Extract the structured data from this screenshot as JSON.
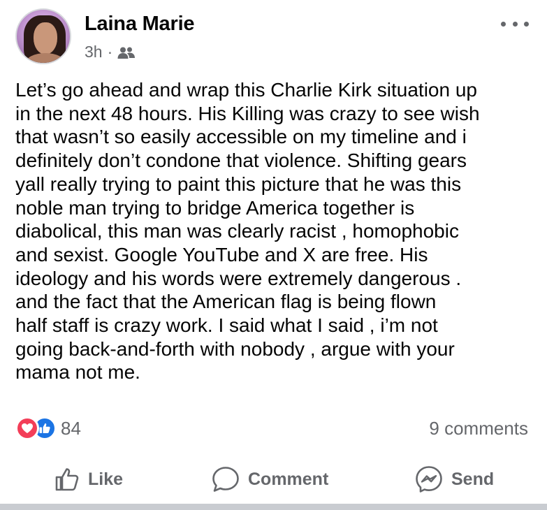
{
  "author": {
    "name": "Laina Marie",
    "time": "3h",
    "separator": "·",
    "audience_icon": "friends-icon"
  },
  "post": {
    "text": "Let’s go ahead and wrap this Charlie Kirk situation up\nin the next 48 hours. His Killing was crazy to see wish\nthat wasn’t so easily accessible on my timeline and i\ndefinitely don’t condone that violence. Shifting gears\nyall really trying to paint this picture that he was this\nnoble man trying to bridge America together is\ndiabolical, this man was clearly racist , homophobic\nand sexist. Google YouTube and X are free. His\nideology and his words were extremely dangerous .\nand  the fact that the American flag is being flown\nhalf staff is crazy work. I said what I said , i’m not\ngoing back-and-forth with nobody , argue with your\nmama not me."
  },
  "engagement": {
    "reaction_count": "84",
    "comments_label": "9 comments"
  },
  "actions": {
    "like_label": "Like",
    "comment_label": "Comment",
    "send_label": "Send"
  },
  "colors": {
    "love": "#f33e58",
    "like": "#1b74e4",
    "secondary_text": "#65676b"
  }
}
